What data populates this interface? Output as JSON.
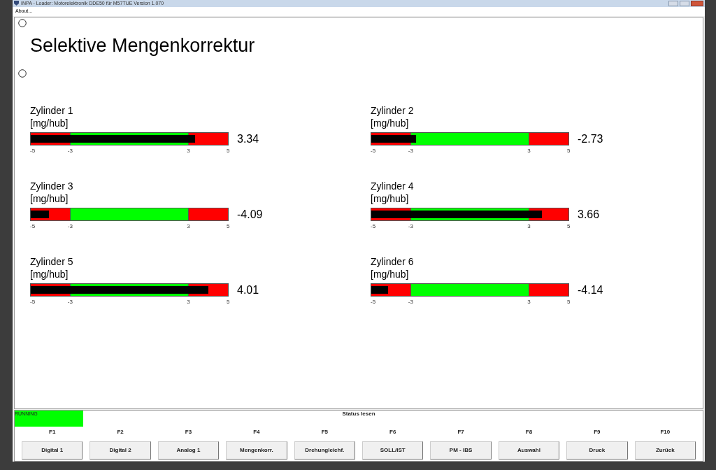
{
  "window": {
    "title": "INPA - Loader: Motorelektronik DDE50 für M57TUE Version 1.070"
  },
  "menu": [
    "About..."
  ],
  "heading": "Selektive Mengenkorrektur",
  "gauges": [
    {
      "label": "Zylinder 1",
      "unit": "[mg/hub]",
      "level": 0.834,
      "reading": "3.34",
      "ticks": [
        "-5",
        "-3",
        "3",
        "5"
      ]
    },
    {
      "label": "Zylinder 2",
      "unit": "[mg/hub]",
      "level": 0.227,
      "reading": "-2.73",
      "ticks": [
        "-5",
        "-3",
        "3",
        "5"
      ]
    },
    {
      "label": "Zylinder 3",
      "unit": "[mg/hub]",
      "level": 0.091,
      "reading": "-4.09",
      "ticks": [
        "-5",
        "-3",
        "3",
        "5"
      ]
    },
    {
      "label": "Zylinder 4",
      "unit": "[mg/hub]",
      "level": 0.866,
      "reading": "3.66",
      "ticks": [
        "-5",
        "-3",
        "3",
        "5"
      ]
    },
    {
      "label": "Zylinder 5",
      "unit": "[mg/hub]",
      "level": 0.901,
      "reading": "4.01",
      "ticks": [
        "-5",
        "-3",
        "3",
        "5"
      ]
    },
    {
      "label": "Zylinder 6",
      "unit": "[mg/hub]",
      "level": 0.086,
      "reading": "-4.14",
      "ticks": [
        "-5",
        "-3",
        "3",
        "5"
      ]
    }
  ],
  "status": {
    "state": "RUNNING",
    "running": true,
    "message": "Status lesen"
  },
  "function_keys": [
    {
      "key": "F1",
      "label": "Digital 1"
    },
    {
      "key": "F2",
      "label": "Digital 2"
    },
    {
      "key": "F3",
      "label": "Analog 1"
    },
    {
      "key": "F4",
      "label": "Mengenkorr."
    },
    {
      "key": "F5",
      "label": "Drehungleichf."
    },
    {
      "key": "F6",
      "label": "SOLL/IST"
    },
    {
      "key": "F7",
      "label": "PM - IBS"
    },
    {
      "key": "F8",
      "label": "Auswahl"
    },
    {
      "key": "F9",
      "label": "Druck"
    },
    {
      "key": "F10",
      "label": "Zurück"
    }
  ]
}
